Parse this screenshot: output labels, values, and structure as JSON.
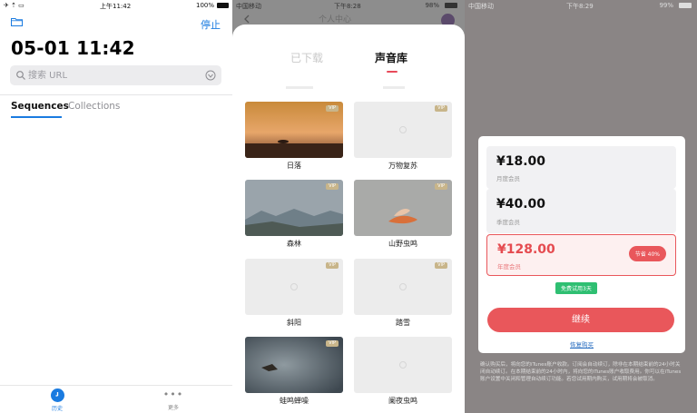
{
  "panel1": {
    "status": {
      "carrier_icons": "✈ ⇡ ▭",
      "time": "上午11:42",
      "battery": "100%"
    },
    "stop_label": "停止",
    "title": "05-01 11:42",
    "search": {
      "placeholder": "搜索 URL"
    },
    "tabs": [
      {
        "label": "Sequences",
        "active": true
      },
      {
        "label": "Collections",
        "active": false
      }
    ],
    "tabbar": [
      {
        "label": "历史",
        "icon": "clock-icon"
      },
      {
        "label": "更多",
        "icon": "more-icon"
      }
    ],
    "colors": {
      "accent": "#1a7be0"
    }
  },
  "panel2": {
    "status": {
      "carrier": "中国移动",
      "time": "下午8:28",
      "battery": "98%"
    },
    "bg_title": "个人中心",
    "sheet_tabs": [
      {
        "label": "已下载",
        "active": false
      },
      {
        "label": "声音库",
        "active": true
      }
    ],
    "sounds": [
      {
        "label": "日落",
        "vip": "VIP",
        "has_image": true
      },
      {
        "label": "万物复苏",
        "vip": "VIP",
        "has_image": false
      },
      {
        "label": "森林",
        "vip": "VIP",
        "has_image": true
      },
      {
        "label": "山野虫鸣",
        "vip": "VIP",
        "has_image": true
      },
      {
        "label": "斜阳",
        "vip": "VIP",
        "has_image": false
      },
      {
        "label": "踏雪",
        "vip": "VIP",
        "has_image": false
      },
      {
        "label": "蛙鸣蝉噪",
        "vip": "VIP",
        "has_image": true
      },
      {
        "label": "阑夜虫鸣",
        "vip": "",
        "has_image": false
      }
    ]
  },
  "panel3": {
    "status": {
      "carrier": "中国移动",
      "time": "下午8:29",
      "battery": "99%"
    },
    "plans": [
      {
        "price": "¥18.00",
        "name": "月度会员",
        "selected": false
      },
      {
        "price": "¥40.00",
        "name": "季度会员",
        "selected": false
      },
      {
        "price": "¥128.00",
        "name": "年度会员",
        "selected": true,
        "badge": "节省 40%"
      }
    ],
    "trial": "免费试用3天",
    "continue_label": "继续",
    "restore_label": "恢复购买",
    "legal_text": "确认购买后，将向您的iTunes账户收款。订阅会自动续订，除非在本期结束前的24小时关闭自动续订。在本期结束前的24小时内，将向您的iTunes账户收取费用。你可以在iTunes账户设置中关闭和管理自动续订功能。若您试用期内购买，试用期将会被取消。",
    "colors": {
      "accent": "#e9575b",
      "trial": "#2fbf72"
    }
  }
}
